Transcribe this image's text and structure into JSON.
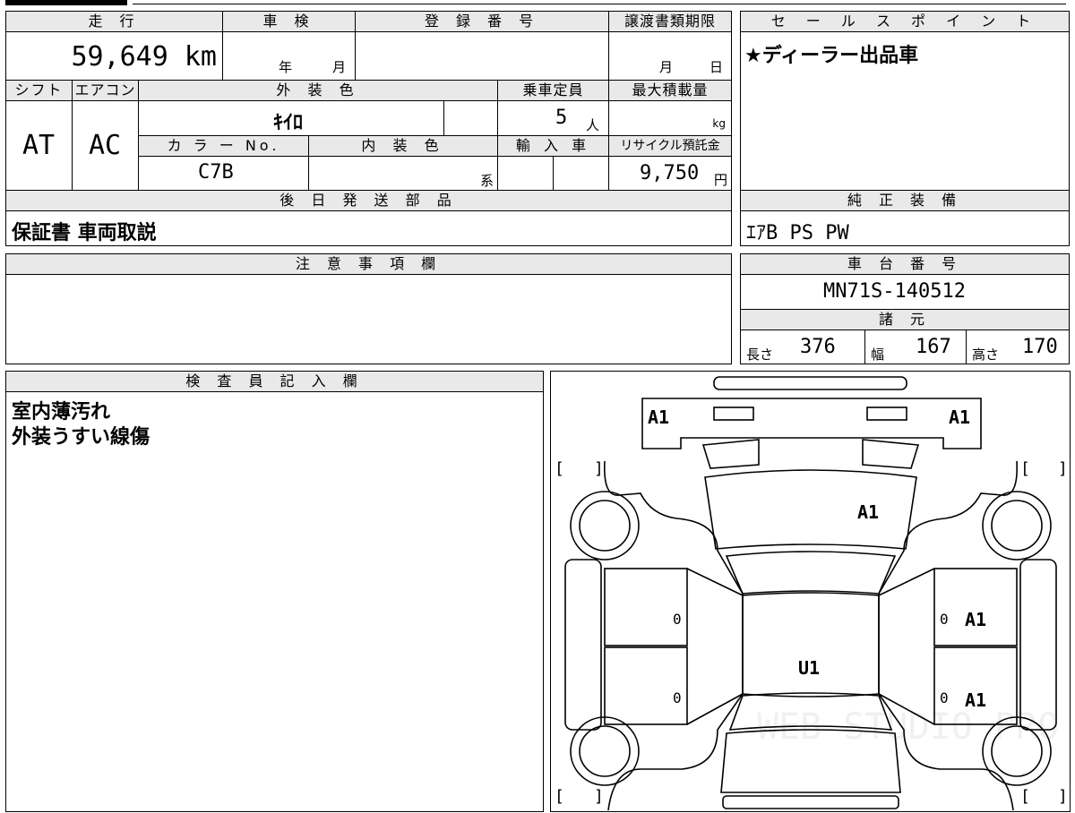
{
  "main_table": {
    "mileage_header": "走 行",
    "mileage_value": "59,649 km",
    "inspection_header": "車 検",
    "inspection_year_label": "年",
    "inspection_month_label": "月",
    "registration_header": "登 録 番 号",
    "transfer_header": "譲渡書類期限",
    "transfer_month_label": "月",
    "transfer_day_label": "日",
    "shift_header": "シフト",
    "shift_value": "AT",
    "ac_header": "エアコン",
    "ac_value": "AC",
    "exterior_header": "外 装 色",
    "exterior_value": "ｷｲﾛ",
    "capacity_header": "乗車定員",
    "capacity_value": "5",
    "capacity_unit": "人",
    "max_load_header": "最大積載量",
    "max_load_unit": "kg",
    "color_no_header": "カ ラ ー No.",
    "color_no_value": "C7B",
    "interior_header": "内 装 色",
    "interior_suffix": "系",
    "import_header": "輸 入 車",
    "recycle_header": "リサイクル預託金",
    "recycle_value": "9,750",
    "recycle_unit": "円"
  },
  "sales_point": {
    "header": "セ ー ル ス ポ イ ン ト",
    "text": "★ディーラー出品車"
  },
  "later_parts": {
    "header": "後 日 発 送 部 品",
    "text": "保証書 車両取説"
  },
  "genuine_equipment": {
    "header": "純 正 装 備",
    "text": "ｴｱB PS PW"
  },
  "notes": {
    "header": "注 意 事 項 欄"
  },
  "chassis": {
    "header": "車 台 番 号",
    "value": "MN71S-140512"
  },
  "specs": {
    "header": "諸 元",
    "length_label": "長さ",
    "length_value": "376",
    "width_label": "幅",
    "width_value": "167",
    "height_label": "高さ",
    "height_value": "170"
  },
  "inspector": {
    "header": "検 査 員 記 入 欄",
    "line1": "室内薄汚れ",
    "line2": "外装うすい線傷"
  },
  "diagram": {
    "marks": {
      "front_left": "A1",
      "front_right": "A1",
      "hood": "A1",
      "roof": "U1",
      "right_front_door": "A1",
      "right_rear_door": "A1",
      "left_front_door_zero": "0",
      "left_rear_door_zero": "0",
      "right_front_door_zero": "0",
      "right_rear_door_zero": "0",
      "bracket_open": "[",
      "bracket_close": "]"
    },
    "watermark": "WEB STUDIO PRO"
  }
}
